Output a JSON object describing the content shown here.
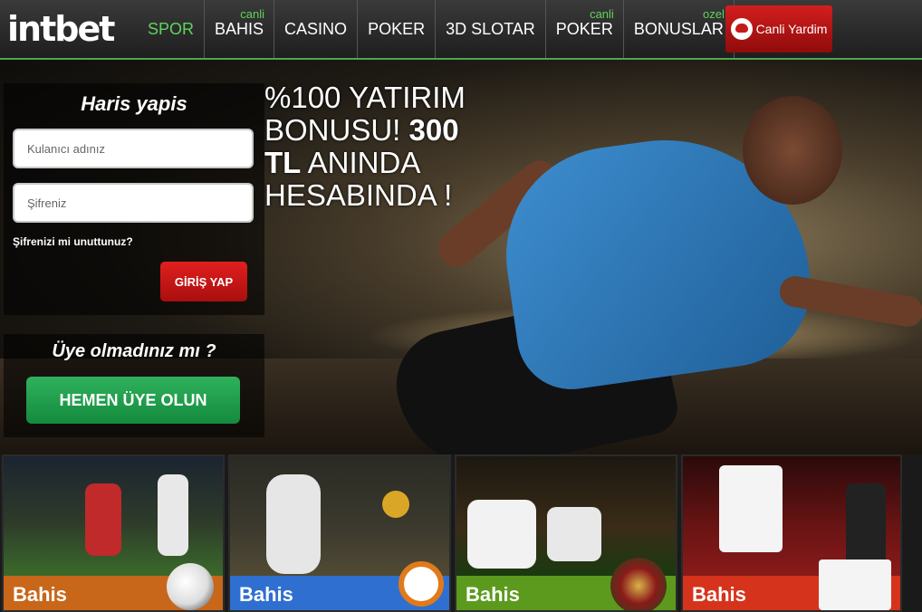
{
  "brand": {
    "logo": "intbet"
  },
  "nav": {
    "items": [
      {
        "sup": "",
        "label": "SPOR",
        "active": true
      },
      {
        "sup": "canli",
        "label": "BAHIS"
      },
      {
        "sup": "",
        "label": "CASINO"
      },
      {
        "sup": "",
        "label": "POKER"
      },
      {
        "sup": "",
        "label": "3D SLOTAR"
      },
      {
        "sup": "canli",
        "label": "POKER"
      },
      {
        "sup": "ozel",
        "label": "BONUSLAR"
      }
    ],
    "help_label": "Canli Yardim"
  },
  "hero": {
    "line1": "%100 YATIRIM",
    "line2a": "BONUSU! ",
    "line2b": "300",
    "line3a": "TL",
    "line3b": " ANINDA",
    "line4": "HESABINDA !"
  },
  "login": {
    "title": "Haris yapis",
    "username_placeholder": "Kulanıcı adınız",
    "password_placeholder": "Şifreniz",
    "forgot": "Şifrenizi mi unuttunuz?",
    "submit": "GİRİŞ YAP"
  },
  "signup": {
    "title": "Üye olmadınız mı ?",
    "button": "HEMEN ÜYE OLUN"
  },
  "cards": [
    {
      "label": "Bahis",
      "bar_color": "#c8661a",
      "icon": "soccer-ball-icon"
    },
    {
      "label": "Bahis",
      "bar_color": "#2f6fd0",
      "icon": "alarm-clock-icon"
    },
    {
      "label": "Bahis",
      "bar_color": "#5c9a1e",
      "icon": "roulette-icon"
    },
    {
      "label": "Bahis",
      "bar_color": "#d6331c",
      "icon": "playing-cards-icon"
    }
  ]
}
